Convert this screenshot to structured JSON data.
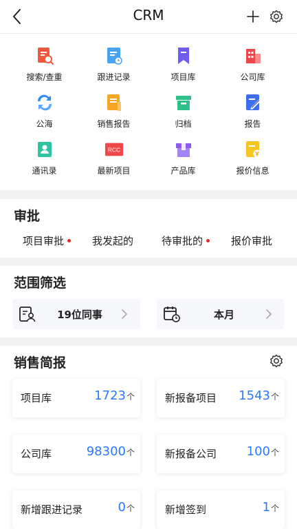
{
  "header": {
    "title": "CRM",
    "back_icon": "back-arrow-icon",
    "add_icon": "plus-icon",
    "settings_icon": "gear-icon"
  },
  "grid": [
    {
      "label": "搜索/查重",
      "icon": "search-doc-icon",
      "color": "#f05a3c"
    },
    {
      "label": "跟进记录",
      "icon": "follow-record-icon",
      "color": "#4aa3f0"
    },
    {
      "label": "项目库",
      "icon": "project-bookmark-icon",
      "color": "#6f5cf0"
    },
    {
      "label": "公司库",
      "icon": "company-building-icon",
      "color": "#f0484a"
    },
    {
      "label": "公海",
      "icon": "public-sea-icon",
      "color": "#2e8bf5"
    },
    {
      "label": "销售报告",
      "icon": "sales-report-icon",
      "color": "#f5a623"
    },
    {
      "label": "归档",
      "icon": "archive-icon",
      "color": "#2fc08a"
    },
    {
      "label": "报告",
      "icon": "report-pen-icon",
      "color": "#3d6ef0"
    },
    {
      "label": "通讯录",
      "icon": "contacts-icon",
      "color": "#2ec4a0"
    },
    {
      "label": "最新项目",
      "icon": "rcc-icon",
      "color": "#f0484a",
      "badge": "RCC"
    },
    {
      "label": "产品库",
      "icon": "product-box-icon",
      "color": "#8a5cf0"
    },
    {
      "label": "报价信息",
      "icon": "quote-yen-icon",
      "color": "#f5c623"
    }
  ],
  "approval": {
    "title": "审批",
    "items": [
      {
        "label": "项目审批",
        "dot": true
      },
      {
        "label": "我发起的",
        "dot": false
      },
      {
        "label": "待审批的",
        "dot": true
      },
      {
        "label": "报价审批",
        "dot": false
      }
    ]
  },
  "scope": {
    "title": "范围筛选",
    "people": "19位同事",
    "period": "本月"
  },
  "sales": {
    "title": "销售简报",
    "unit": "个",
    "cards": [
      {
        "label": "项目库",
        "value": "1723"
      },
      {
        "label": "新报备项目",
        "value": "1543"
      },
      {
        "label": "公司库",
        "value": "98300"
      },
      {
        "label": "新报备公司",
        "value": "100"
      },
      {
        "label": "新增跟进记录",
        "value": "0"
      },
      {
        "label": "新增签到",
        "value": "1"
      }
    ]
  },
  "colors": {
    "accent": "#2979ff",
    "dot": "#e02929"
  }
}
